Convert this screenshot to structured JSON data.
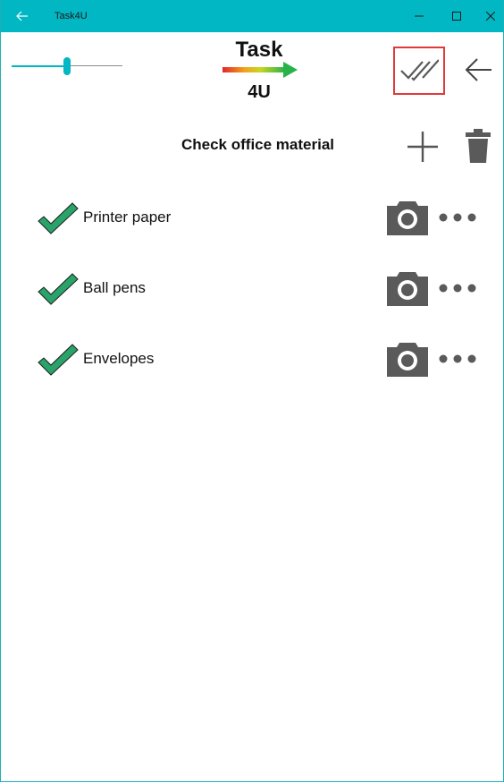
{
  "titlebar": {
    "title": "Task4U",
    "back_icon": "arrow-left-icon",
    "minimize_icon": "minimize-icon",
    "maximize_icon": "maximize-icon",
    "close_icon": "close-icon"
  },
  "header": {
    "zoom_slider_fraction": 0.5,
    "logo_top": "Task",
    "logo_bottom": "4U",
    "done_all_icon": "double-check-icon",
    "back_icon": "arrow-left-icon"
  },
  "list": {
    "title": "Check office material",
    "add_icon": "plus-icon",
    "delete_icon": "trash-icon",
    "items": [
      {
        "label": "Printer paper",
        "checked": true
      },
      {
        "label": "Ball pens",
        "checked": true
      },
      {
        "label": "Envelopes",
        "checked": true
      }
    ]
  },
  "colors": {
    "accent": "#00b7c3",
    "check_fill": "#2aa36a",
    "icon_gray": "#5a5a5a",
    "highlight_border": "#e03a3a"
  }
}
